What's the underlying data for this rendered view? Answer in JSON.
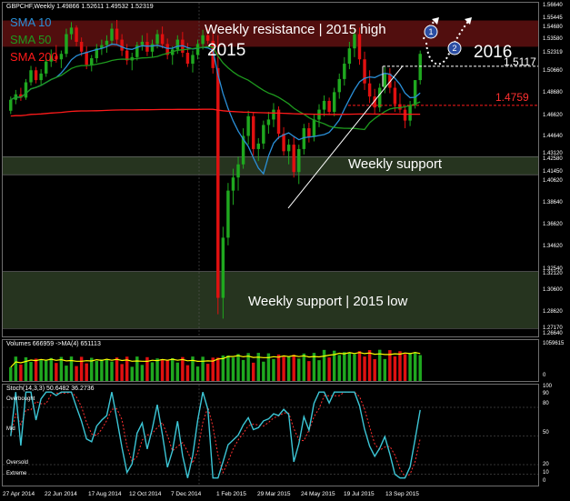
{
  "chart_header": "GBPCHF,Weekly  1.49866 1.52611 1.49532 1.52319",
  "indicators": {
    "sma10": "SMA 10",
    "sma50": "SMA 50",
    "sma200": "SMA 200"
  },
  "annotations": {
    "resistance": "Weekly resistance | 2015 high",
    "support1": "Weekly support",
    "support2": "Weekly support | 2015 low",
    "year2015": "2015",
    "year2016": "2016",
    "level_15117": "1.5117",
    "level_14759": "1.4759",
    "circle1": "1",
    "circle2": "2"
  },
  "colors": {
    "bull": "#1fa81f",
    "bear": "#e01010",
    "sma10": "#2a8fd8",
    "sma50": "#1e9a1e",
    "sma200": "#ff1a1a",
    "resistance_zone": "#5a1010",
    "support_zone": "#2a3a22",
    "stoch_main": "#3cc6d6",
    "stoch_signal": "#ff3030",
    "volume_ma": "#ffff00"
  },
  "price_axis": [
    "1.56640",
    "1.55445",
    "1.54680",
    "1.53580",
    "1.52319",
    "1.50660",
    "1.48680",
    "1.46620",
    "1.44640",
    "1.43120",
    "1.42580",
    "1.41450",
    "1.40620",
    "1.38640",
    "1.36620",
    "1.34620",
    "1.32540",
    "1.32120",
    "1.30600",
    "1.28620",
    "1.27170",
    "1.26640"
  ],
  "volume_panel": {
    "label": "Volumes 666959  ->MA(4) 651113",
    "axis": [
      "1059615",
      "0"
    ]
  },
  "stoch_panel": {
    "label": "Stoch(14,3,3) 50.6482 36.2736",
    "axis": [
      "100",
      "90",
      "80",
      "50",
      "20",
      "10",
      "0"
    ],
    "levels": [
      "Overbought",
      "Mid",
      "Oversold",
      "Extreme"
    ]
  },
  "time_axis": [
    "27 Apr 2014",
    "22 Jun 2014",
    "17 Aug 2014",
    "12 Oct 2014",
    "7 Dec 2014",
    "1 Feb 2015",
    "29 Mar 2015",
    "24 May 2015",
    "19 Jul 2015",
    "13 Sep 2015"
  ],
  "chart_data": {
    "type": "candlestick",
    "title": "GBPCHF,Weekly",
    "ylim": [
      1.2664,
      1.5664
    ],
    "candles": [
      [
        1.471,
        1.484,
        1.468,
        1.481
      ],
      [
        1.481,
        1.49,
        1.477,
        1.486
      ],
      [
        1.486,
        1.492,
        1.48,
        1.483
      ],
      [
        1.483,
        1.5,
        1.481,
        1.497
      ],
      [
        1.497,
        1.512,
        1.494,
        1.508
      ],
      [
        1.508,
        1.511,
        1.496,
        1.499
      ],
      [
        1.499,
        1.509,
        1.495,
        1.505
      ],
      [
        1.505,
        1.519,
        1.502,
        1.516
      ],
      [
        1.516,
        1.527,
        1.511,
        1.521
      ],
      [
        1.521,
        1.531,
        1.515,
        1.518
      ],
      [
        1.518,
        1.526,
        1.51,
        1.523
      ],
      [
        1.523,
        1.546,
        1.52,
        1.541
      ],
      [
        1.541,
        1.552,
        1.536,
        1.547
      ],
      [
        1.547,
        1.549,
        1.53,
        1.534
      ],
      [
        1.534,
        1.538,
        1.521,
        1.525
      ],
      [
        1.525,
        1.53,
        1.509,
        1.513
      ],
      [
        1.513,
        1.522,
        1.507,
        1.519
      ],
      [
        1.519,
        1.532,
        1.515,
        1.528
      ],
      [
        1.528,
        1.536,
        1.522,
        1.531
      ],
      [
        1.531,
        1.54,
        1.524,
        1.535
      ],
      [
        1.535,
        1.551,
        1.531,
        1.546
      ],
      [
        1.546,
        1.554,
        1.532,
        1.536
      ],
      [
        1.536,
        1.541,
        1.521,
        1.526
      ],
      [
        1.526,
        1.532,
        1.513,
        1.517
      ],
      [
        1.517,
        1.524,
        1.508,
        1.52
      ],
      [
        1.52,
        1.534,
        1.517,
        1.531
      ],
      [
        1.531,
        1.54,
        1.526,
        1.534
      ],
      [
        1.534,
        1.542,
        1.521,
        1.525
      ],
      [
        1.525,
        1.536,
        1.52,
        1.532
      ],
      [
        1.532,
        1.545,
        1.528,
        1.541
      ],
      [
        1.541,
        1.548,
        1.528,
        1.532
      ],
      [
        1.532,
        1.537,
        1.518,
        1.522
      ],
      [
        1.522,
        1.53,
        1.513,
        1.527
      ],
      [
        1.527,
        1.54,
        1.523,
        1.536
      ],
      [
        1.536,
        1.543,
        1.52,
        1.524
      ],
      [
        1.524,
        1.533,
        1.511,
        1.514
      ],
      [
        1.514,
        1.526,
        1.506,
        1.522
      ],
      [
        1.522,
        1.536,
        1.518,
        1.532
      ],
      [
        1.532,
        1.545,
        1.527,
        1.54
      ],
      [
        1.54,
        1.546,
        1.532,
        1.535
      ],
      [
        1.535,
        1.542,
        1.505,
        1.51
      ],
      [
        1.51,
        1.54,
        1.285,
        1.3
      ],
      [
        1.3,
        1.365,
        1.281,
        1.355
      ],
      [
        1.355,
        1.405,
        1.348,
        1.398
      ],
      [
        1.398,
        1.418,
        1.385,
        1.41
      ],
      [
        1.41,
        1.429,
        1.398,
        1.422
      ],
      [
        1.422,
        1.455,
        1.418,
        1.448
      ],
      [
        1.448,
        1.471,
        1.44,
        1.466
      ],
      [
        1.466,
        1.47,
        1.43,
        1.436
      ],
      [
        1.436,
        1.446,
        1.425,
        1.441
      ],
      [
        1.441,
        1.462,
        1.436,
        1.458
      ],
      [
        1.458,
        1.47,
        1.45,
        1.463
      ],
      [
        1.463,
        1.478,
        1.456,
        1.472
      ],
      [
        1.472,
        1.475,
        1.445,
        1.45
      ],
      [
        1.45,
        1.456,
        1.43,
        1.434
      ],
      [
        1.434,
        1.445,
        1.422,
        1.44
      ],
      [
        1.44,
        1.448,
        1.41,
        1.415
      ],
      [
        1.415,
        1.44,
        1.404,
        1.436
      ],
      [
        1.436,
        1.459,
        1.431,
        1.455
      ],
      [
        1.455,
        1.46,
        1.442,
        1.447
      ],
      [
        1.447,
        1.468,
        1.443,
        1.463
      ],
      [
        1.463,
        1.477,
        1.456,
        1.472
      ],
      [
        1.472,
        1.485,
        1.466,
        1.48
      ],
      [
        1.48,
        1.483,
        1.467,
        1.47
      ],
      [
        1.47,
        1.492,
        1.466,
        1.488
      ],
      [
        1.488,
        1.505,
        1.482,
        1.5
      ],
      [
        1.5,
        1.52,
        1.494,
        1.514
      ],
      [
        1.514,
        1.534,
        1.509,
        1.528
      ],
      [
        1.528,
        1.546,
        1.52,
        1.541
      ],
      [
        1.541,
        1.547,
        1.513,
        1.518
      ],
      [
        1.518,
        1.525,
        1.49,
        1.496
      ],
      [
        1.496,
        1.508,
        1.478,
        1.484
      ],
      [
        1.484,
        1.491,
        1.468,
        1.474
      ],
      [
        1.474,
        1.496,
        1.47,
        1.492
      ],
      [
        1.492,
        1.511,
        1.487,
        1.505
      ],
      [
        1.505,
        1.51,
        1.487,
        1.492
      ],
      [
        1.492,
        1.498,
        1.47,
        1.477
      ],
      [
        1.477,
        1.487,
        1.469,
        1.472
      ],
      [
        1.472,
        1.475,
        1.455,
        1.462
      ],
      [
        1.462,
        1.48,
        1.457,
        1.476
      ],
      [
        1.476,
        1.499,
        1.473,
        1.499
      ],
      [
        1.499,
        1.526,
        1.495,
        1.523
      ]
    ]
  }
}
